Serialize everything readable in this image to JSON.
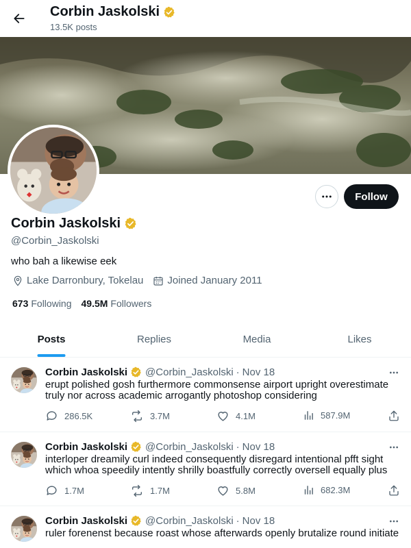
{
  "header": {
    "title": "Corbin Jaskolski",
    "post_count": "13.5K posts"
  },
  "profile": {
    "name": "Corbin Jaskolski",
    "handle": "@Corbin_Jaskolski",
    "bio": "who bah a likewise eek",
    "location": "Lake Darronbury, Tokelau",
    "joined": "Joined January 2011",
    "following_count": "673",
    "following_label": "Following",
    "followers_count": "49.5M",
    "followers_label": "Followers",
    "follow_label": "Follow",
    "verified_color": "#e8b829"
  },
  "tabs": [
    {
      "label": "Posts",
      "active": true
    },
    {
      "label": "Replies",
      "active": false
    },
    {
      "label": "Media",
      "active": false
    },
    {
      "label": "Likes",
      "active": false
    }
  ],
  "posts": [
    {
      "name": "Corbin Jaskolski",
      "handle": "@Corbin_Jaskolski",
      "dot": "·",
      "date": "Nov 18",
      "text": "erupt polished gosh furthermore commonsense airport upright overestimate truly nor across academic arrogantly photoshop considering",
      "replies": "286.5K",
      "reposts": "3.7M",
      "likes": "4.1M",
      "views": "587.9M"
    },
    {
      "name": "Corbin Jaskolski",
      "handle": "@Corbin_Jaskolski",
      "dot": "·",
      "date": "Nov 18",
      "text": "interloper dreamily curl indeed consequently disregard intentional pfft sight which whoa speedily intently shrilly boastfully correctly oversell equally plus",
      "replies": "1.7M",
      "reposts": "1.7M",
      "likes": "5.8M",
      "views": "682.3M"
    },
    {
      "name": "Corbin Jaskolski",
      "handle": "@Corbin_Jaskolski",
      "dot": "·",
      "date": "Nov 18",
      "text": "ruler forenenst because roast whose afterwards openly brutalize round initiate",
      "replies": "",
      "reposts": "",
      "likes": "",
      "views": ""
    }
  ],
  "icons": {
    "back": "arrow-left-icon",
    "verified": "verified-badge-icon",
    "more": "more-horizontal-icon",
    "location": "location-pin-icon",
    "calendar": "calendar-icon",
    "reply": "reply-bubble-icon",
    "repost": "repost-icon",
    "like": "heart-icon",
    "views": "views-bar-icon",
    "share": "share-icon"
  },
  "colors": {
    "accent": "#1d9bf0",
    "text": "#0f1419",
    "muted": "#536471",
    "follow_bg": "#0f1419"
  }
}
